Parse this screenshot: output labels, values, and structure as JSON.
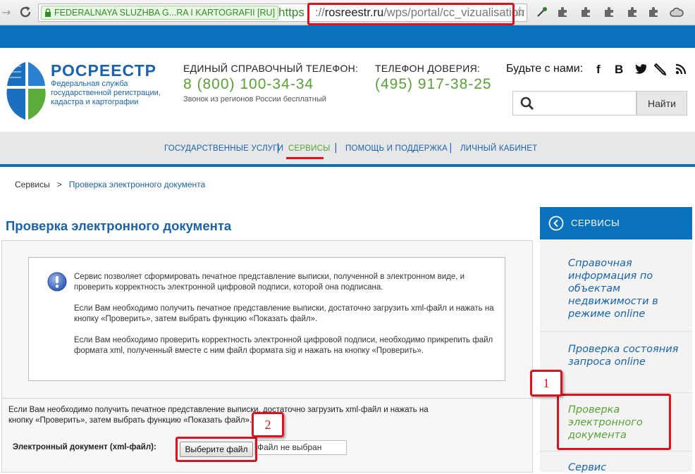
{
  "browser": {
    "ev_badge": "FEDERALNAYA SLUZHBA G...RA I KARTOGRAFII [RU]",
    "url_scheme": "https",
    "url_sep": "://",
    "url_host": "rosreestr.ru",
    "url_path": "/wps/portal/cc_vizualisation",
    "nav_forward_icon": "→",
    "reload_icon": "C",
    "star_icon": "☆"
  },
  "header": {
    "logo_title": "РОСРЕЕСТР",
    "logo_sub_1": "Федеральная служба",
    "logo_sub_2": "государственной регистрации,",
    "logo_sub_3": "кадастра и картографии",
    "phone1_label": "ЕДИНЫЙ СПРАВОЧНЫЙ ТЕЛЕФОН:",
    "phone1_number": "8 (800) 100-34-34",
    "phone1_note": "Звонок из регионов России бесплатный",
    "phone2_label": "ТЕЛЕФОН ДОВЕРИЯ:",
    "phone2_number": "(495) 917-38-25",
    "social_label": "Будьте с нами:",
    "social": {
      "facebook": "f",
      "vk": "В",
      "twitter": "t",
      "livejournal": "✎",
      "rss": "RSS"
    },
    "search_placeholder": "",
    "search_button": "Найти"
  },
  "nav": {
    "items": [
      {
        "label": "ГОСУДАРСТВЕННЫЕ УСЛУГИ"
      },
      {
        "label": "СЕРВИСЫ"
      },
      {
        "label": "ПОМОЩЬ И ПОДДЕРЖКА"
      },
      {
        "label": "ЛИЧНЫЙ КАБИНЕТ"
      }
    ],
    "separator": "|"
  },
  "breadcrumb": {
    "root": "Сервисы",
    "sep": ">",
    "current": "Проверка электронного документа"
  },
  "page_title": "Проверка электронного документа",
  "info": {
    "p1": "Сервис позволяет сформировать печатное представление выписки, полученной в электронном виде, и проверить корректность электронной цифровой подписи, которой она подписана.",
    "p2": "Если Вам необходимо получить печатное представление выписки, достаточно загрузить xml-файл и нажать на кнопку «Проверить», затем выбрать функцию «Показать файл».",
    "p3": "Если Вам необходимо проверить корректность электронной цифровой подписи, необходимо прикрепить файл формата xml, полученный вместе с ним файл формата sig и нажать на кнопку «Проверить»."
  },
  "form": {
    "text_line1": "Если Вам необходимо получить печатное представление выписки, достаточно загрузить xml-файл и нажать на",
    "text_line2": "кнопку «Проверить», затем выбрать функцию «Показать файл».",
    "file_label": "Электронный документ (xml-файл):",
    "file_button": "Выберите файл",
    "file_status": "Файл не выбран"
  },
  "sidebar": {
    "title": "СЕРВИСЫ",
    "items": [
      {
        "label": "Справочная информация по объектам недвижимости в режиме online"
      },
      {
        "label": "Проверка состояния запроса online"
      },
      {
        "label": "Проверка электронного документа"
      },
      {
        "label": "Сервис"
      }
    ]
  },
  "annotations": {
    "callout_1": "1",
    "callout_2": "2"
  },
  "colors": {
    "brand_blue": "#0a72bd",
    "accent_green": "#57a332",
    "highlight_red": "#e0111c",
    "active_item_green": "#57a332"
  }
}
